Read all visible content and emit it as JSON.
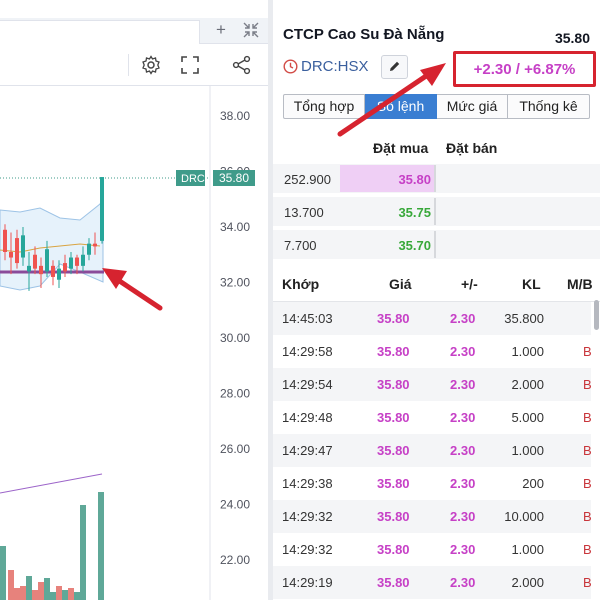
{
  "chart": {
    "ticker_label": "DRC",
    "price_label": "35.80",
    "y_axis": [
      "38.00",
      "36.00",
      "34.00",
      "32.00",
      "30.00",
      "28.00",
      "26.00",
      "24.00",
      "22.00"
    ],
    "colors": {
      "up": "#26a69a",
      "down": "#ef5350",
      "price_tag": "#3f9b8a",
      "sma": "#9c64c9"
    }
  },
  "toolbar": {
    "plus_icon": "plus-icon",
    "collapse_icon": "collapse-icon",
    "settings_icon": "gear-icon",
    "fullscreen_icon": "fullscreen-icon",
    "share_icon": "share-icon"
  },
  "quote": {
    "company_name": "CTCP Cao Su Đà Nẵng",
    "last_price": "35.80",
    "ticker": "DRC:HSX",
    "change": "+2.30 / +6.87%",
    "colors": {
      "ceiling": "#c640c6",
      "up": "#38a83a",
      "highlight_border": "#d6232f"
    }
  },
  "tabs": [
    {
      "label": "Tổng hợp",
      "active": false
    },
    {
      "label": "Sổ lệnh",
      "active": true
    },
    {
      "label": "Mức giá",
      "active": false
    },
    {
      "label": "Thống kê",
      "active": false
    }
  ],
  "order_book": {
    "headers": {
      "buy": "Đặt mua",
      "sell": "Đặt bán"
    },
    "rows": [
      {
        "volume": "252.900",
        "bid_price": "35.80",
        "bid_level": 1.0,
        "color": "#c640c6"
      },
      {
        "volume": "13.700",
        "bid_price": "35.75",
        "bid_level": 0.0,
        "color": "#38a83a"
      },
      {
        "volume": "7.700",
        "bid_price": "35.70",
        "bid_level": 0.0,
        "color": "#38a83a"
      }
    ]
  },
  "matched": {
    "headers": {
      "time": "Khớp",
      "price": "Giá",
      "change": "+/-",
      "volume": "KL",
      "side": "M/B"
    },
    "rows": [
      {
        "time": "14:45:03",
        "price": "35.80",
        "change": "2.30",
        "volume": "35.800",
        "side": ""
      },
      {
        "time": "14:29:58",
        "price": "35.80",
        "change": "2.30",
        "volume": "1.000",
        "side": "B"
      },
      {
        "time": "14:29:54",
        "price": "35.80",
        "change": "2.30",
        "volume": "2.000",
        "side": "B"
      },
      {
        "time": "14:29:48",
        "price": "35.80",
        "change": "2.30",
        "volume": "5.000",
        "side": "B"
      },
      {
        "time": "14:29:47",
        "price": "35.80",
        "change": "2.30",
        "volume": "1.000",
        "side": "B"
      },
      {
        "time": "14:29:38",
        "price": "35.80",
        "change": "2.30",
        "volume": "200",
        "side": "B"
      },
      {
        "time": "14:29:32",
        "price": "35.80",
        "change": "2.30",
        "volume": "10.000",
        "side": "B"
      },
      {
        "time": "14:29:32",
        "price": "35.80",
        "change": "2.30",
        "volume": "1.000",
        "side": "B"
      },
      {
        "time": "14:29:19",
        "price": "35.80",
        "change": "2.30",
        "volume": "2.000",
        "side": "B"
      }
    ]
  }
}
